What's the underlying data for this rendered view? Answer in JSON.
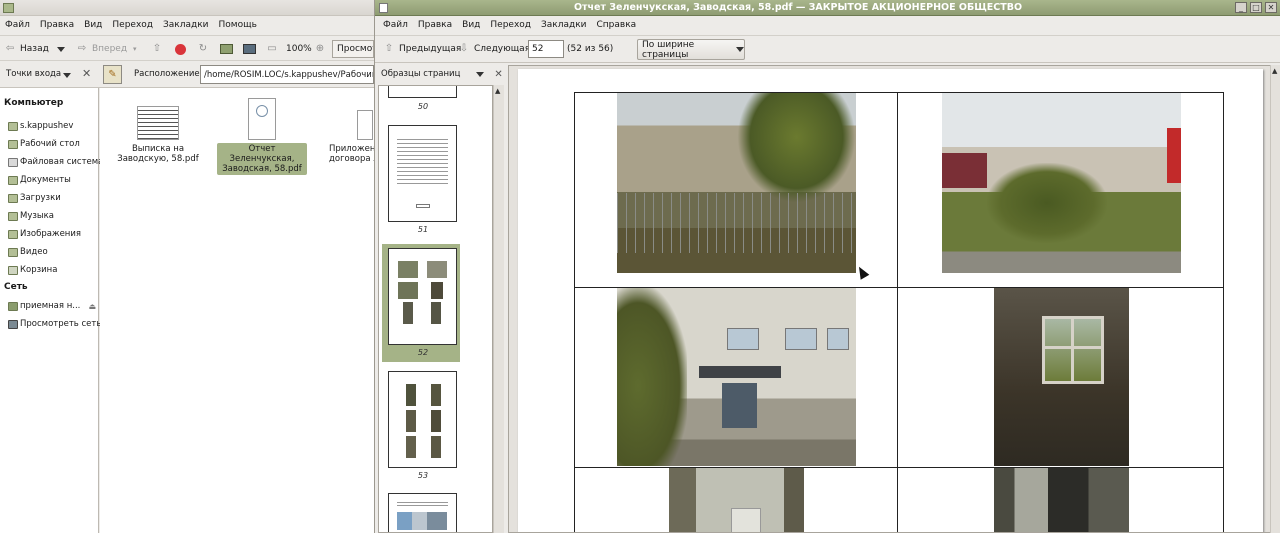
{
  "file_manager": {
    "menu": [
      "Файл",
      "Правка",
      "Вид",
      "Переход",
      "Закладки",
      "Помощь"
    ],
    "toolbar": {
      "back_label": "Назад",
      "forward_label": "Вперед",
      "zoom_level": "100%",
      "view_label": "Просмот"
    },
    "locbar": {
      "places_label": "Точки входа",
      "location_label": "Расположение:",
      "path_value": "/home/ROSIM.LOC/s.kappushev/Рабочий сто"
    },
    "sidebar": {
      "computer_heading": "Компьютер",
      "computer_items": [
        "s.kappushev",
        "Рабочий стол",
        "Файловая система",
        "Документы",
        "Загрузки",
        "Музыка",
        "Изображения",
        "Видео",
        "Корзина"
      ],
      "network_heading": "Сеть",
      "network_items": [
        "приемная н...",
        "Просмотреть сеть"
      ]
    },
    "files": [
      {
        "name": "Выписка на Заводскую, 58.pdf",
        "line1": "Выписка на",
        "line2": "Заводскую, 58.pdf"
      },
      {
        "name": "Отчет Зеленчукская, Заводская, 58.pdf",
        "line1": "Отчет Зеленчукская,",
        "line2": "Заводская, 58.pdf",
        "selected": true
      },
      {
        "name": "Приложение договора",
        "line1": "Приложен",
        "line2": "договора л"
      }
    ]
  },
  "viewer": {
    "title": "Отчет Зеленчукская, Заводская, 58.pdf — ЗАКРЫТОЕ АКЦИОНЕРНОЕ ОБЩЕСТВО",
    "menu": [
      "Файл",
      "Правка",
      "Вид",
      "Переход",
      "Закладки",
      "Справка"
    ],
    "toolbar": {
      "prev_label": "Предыдущая",
      "next_label": "Следующая",
      "page_value": "52",
      "page_count": "(52 из 56)",
      "zoom_label": "По ширине страницы"
    },
    "side_panel": {
      "title": "Образцы страниц",
      "thumbnails": [
        "50",
        "51",
        "52",
        "53"
      ],
      "selected_page": "52"
    },
    "colors": {
      "accent": "#a5b387",
      "titlebar": "#9aa77e"
    }
  }
}
